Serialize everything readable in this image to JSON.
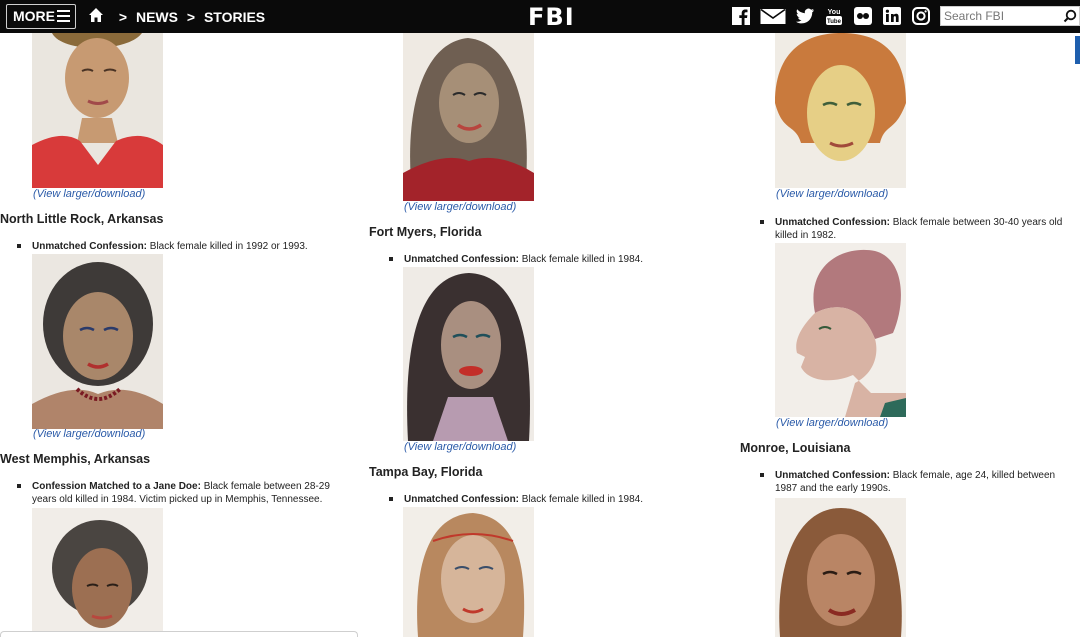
{
  "topbar": {
    "more_label": "MORE",
    "breadcrumb": [
      "NEWS",
      "STORIES"
    ],
    "logo": "FBI",
    "social_icons": [
      "facebook-icon",
      "email-icon",
      "twitter-icon",
      "youtube-icon",
      "flickr-icon",
      "linkedin-icon",
      "instagram-icon"
    ],
    "search_placeholder": "Search FBI"
  },
  "view_link": "(View larger/download)",
  "columns": {
    "left": {
      "sections": [
        {
          "heading": "North Little Rock, Arkansas",
          "label": "Unmatched Confession:",
          "text": " Black female killed in 1992 or 1993."
        },
        {
          "heading": "West Memphis, Arkansas",
          "label": "Confession Matched to a Jane Doe:",
          "text": " Black female between 28-29 years old killed in 1984. Victim picked up in Memphis, Tennessee."
        }
      ]
    },
    "middle": {
      "sections": [
        {
          "heading": "Fort Myers, Florida",
          "label": "Unmatched Confession:",
          "text": " Black female killed in 1984."
        },
        {
          "heading": "Tampa Bay, Florida",
          "label": "Unmatched Confession:",
          "text": " Black female killed in 1984."
        }
      ]
    },
    "right": {
      "sections": [
        {
          "heading": "",
          "label": "Unmatched Confession:",
          "text": " Black female between 30-40 years old killed in 1982."
        },
        {
          "heading": "Monroe, Louisiana",
          "label": "Unmatched Confession:",
          "text": " Black female, age 24, killed between 1987 and the early 1990s."
        }
      ]
    }
  },
  "colors": {
    "topbar_bg": "#0a0a0a",
    "link": "#2a5aa8",
    "accent_tab": "#1f5fae"
  }
}
